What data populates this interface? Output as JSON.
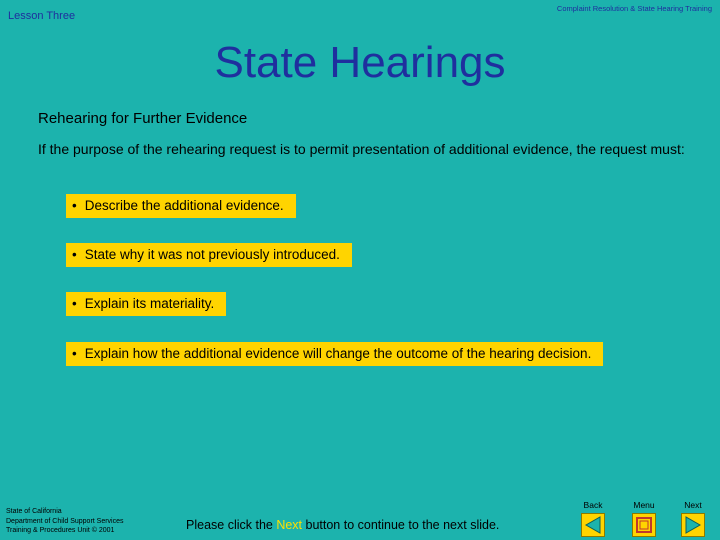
{
  "header": {
    "lesson": "Lesson Three",
    "training": "Complaint Resolution & State Hearing Training"
  },
  "main": {
    "title": "State Hearings",
    "subtitle": "Rehearing for Further Evidence",
    "intro": "If the purpose of the rehearing request is to permit presentation of additional evidence, the request must:",
    "bullets": [
      "Describe the additional evidence.",
      "State why it was not previously introduced.",
      "Explain its materiality.",
      "Explain how the additional evidence will change the outcome of the hearing decision."
    ]
  },
  "footer": {
    "org_lines": [
      "State of California",
      "Department of Child Support Services",
      "Training & Procedures Unit  © 2001"
    ],
    "message_before": "Please click the ",
    "message_highlight": "Next",
    "message_after": " button to continue to the next slide."
  },
  "nav": {
    "back_label": "Back",
    "menu_label": "Menu",
    "next_label": "Next"
  },
  "colors": {
    "background": "#1cb3ad",
    "title": "#1f2f9e",
    "bullet_bg": "#ffd400",
    "highlight": "#ffe100",
    "icon_fill": "#1cb3ad"
  }
}
